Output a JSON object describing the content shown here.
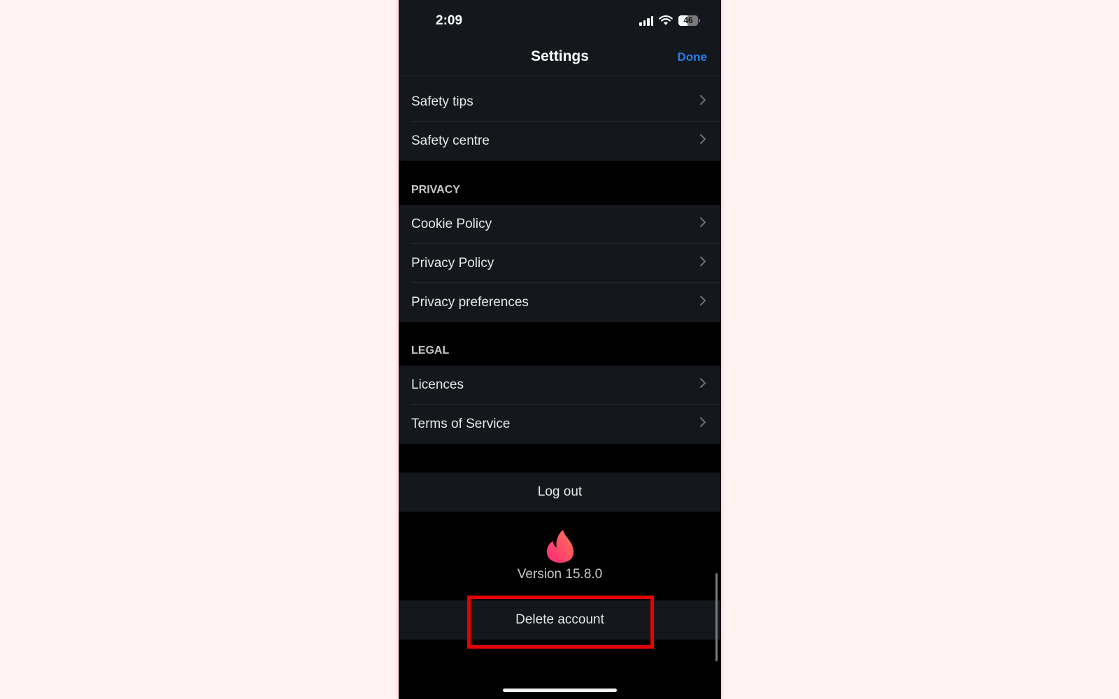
{
  "status_bar": {
    "time": "2:09",
    "battery_percent": 46,
    "battery_label": "46",
    "icons": [
      "cellular-signal-icon",
      "wifi-icon",
      "battery-icon"
    ]
  },
  "header": {
    "title": "Settings",
    "done_label": "Done",
    "accent_color": "#2b7de9"
  },
  "sections": [
    {
      "label": "",
      "items": [
        {
          "label": "Safety tips",
          "icon": "chevron-right-icon"
        },
        {
          "label": "Safety centre",
          "icon": "chevron-right-icon"
        }
      ]
    },
    {
      "label": "PRIVACY",
      "items": [
        {
          "label": "Cookie Policy",
          "icon": "chevron-right-icon"
        },
        {
          "label": "Privacy Policy",
          "icon": "chevron-right-icon"
        },
        {
          "label": "Privacy preferences",
          "icon": "chevron-right-icon"
        }
      ]
    },
    {
      "label": "LEGAL",
      "items": [
        {
          "label": "Licences",
          "icon": "chevron-right-icon"
        },
        {
          "label": "Terms of Service",
          "icon": "chevron-right-icon"
        }
      ]
    }
  ],
  "actions": {
    "logout_label": "Log out",
    "delete_label": "Delete account"
  },
  "footer": {
    "logo_icon": "flame-logo-icon",
    "version": "Version 15.8.0"
  },
  "annotation": {
    "highlight_color": "#e60000",
    "target": "Delete account"
  }
}
